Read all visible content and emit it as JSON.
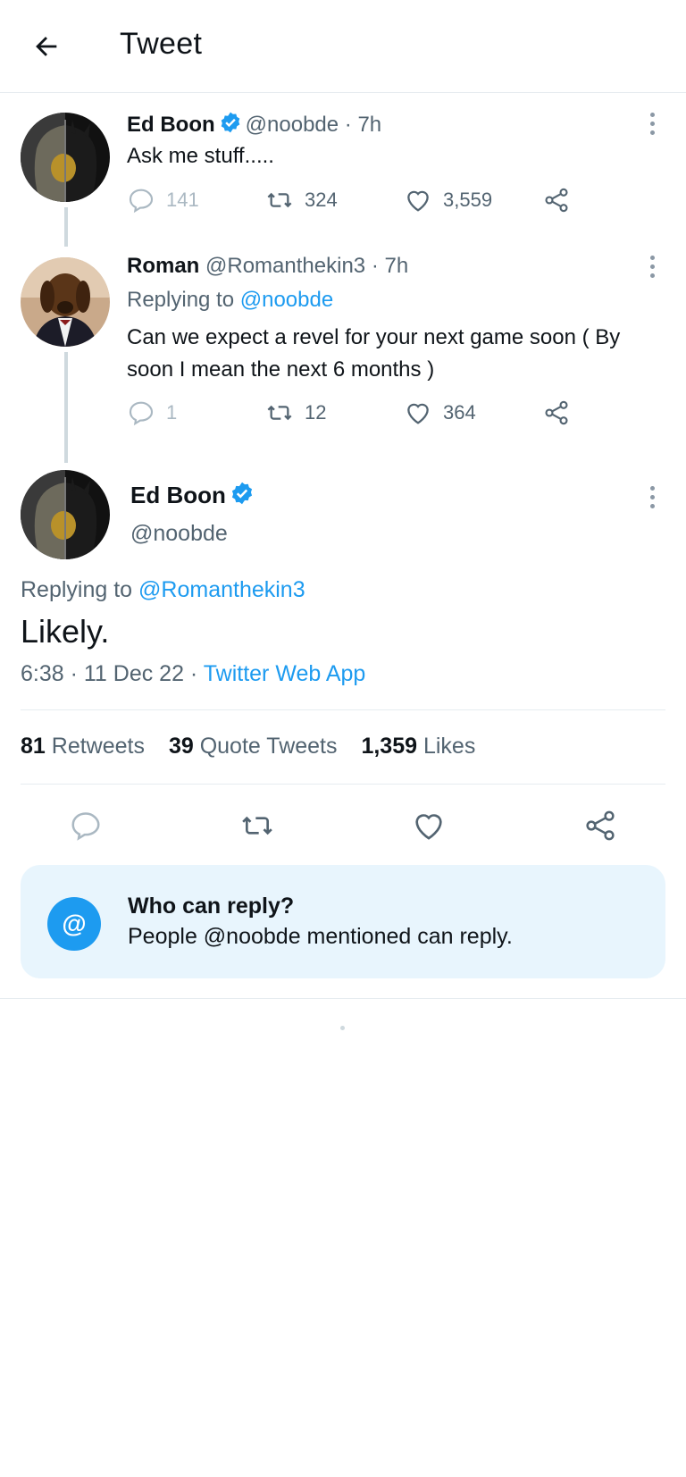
{
  "header": {
    "title": "Tweet"
  },
  "tweets": [
    {
      "name": "Ed Boon",
      "handle": "@noobde",
      "time": "· 7h",
      "text": "Ask me stuff.....",
      "replies": "141",
      "retweets": "324",
      "likes": "3,559"
    },
    {
      "name": "Roman",
      "handle": "@Romanthekin3",
      "time": "· 7h",
      "replying_prefix": "Replying to",
      "replying_to": "@noobde",
      "text_line1": "Can we expect a revel for your next game soon ( By",
      "text_line2": "soon I mean the next 6 months )",
      "replies": "1",
      "retweets": "12",
      "likes": "364"
    }
  ],
  "main": {
    "name": "Ed Boon",
    "handle": "@noobde",
    "replying_prefix": "Replying to",
    "replying_to": "@Romanthekin3",
    "text": "Likely.",
    "datetime": "6:38 · 11 Dec 22 ·",
    "source": "Twitter Web App",
    "stats": {
      "retweets_count": "81",
      "retweets_label": "Retweets",
      "quotes_count": "39",
      "quotes_label": "Quote Tweets",
      "likes_count": "1,359",
      "likes_label": "Likes"
    }
  },
  "who_can_reply": {
    "icon": "@",
    "title": "Who can reply?",
    "subtitle": "People @noobde mentioned can reply."
  },
  "colors": {
    "accent": "#1d9bf0",
    "muted": "#536471",
    "reply_box_bg": "#e8f5fd"
  }
}
